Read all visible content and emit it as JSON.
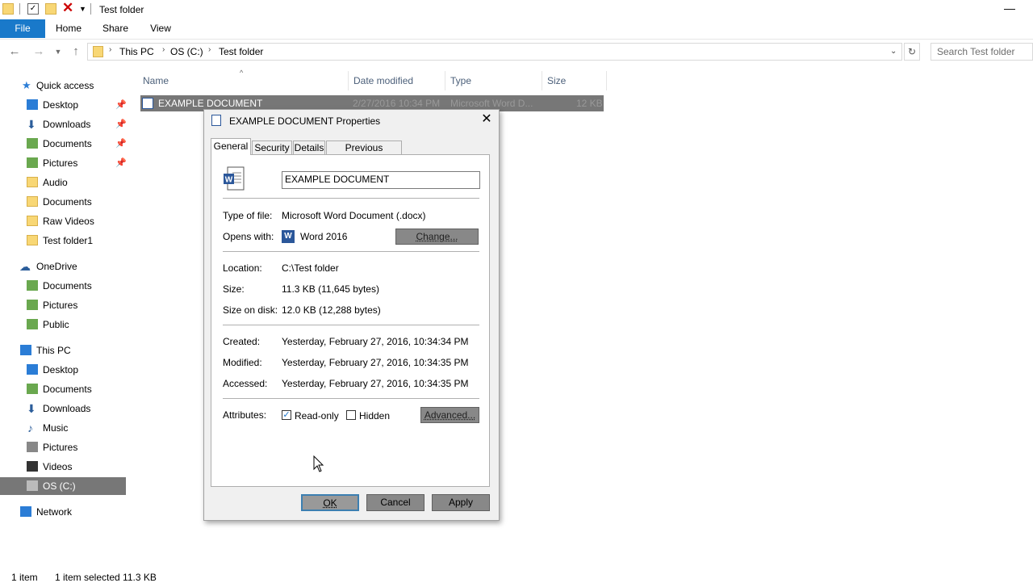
{
  "window": {
    "title": "Test folder"
  },
  "ribbon": {
    "tabs": [
      "File",
      "Home",
      "Share",
      "View"
    ]
  },
  "address": {
    "crumbs": [
      "This PC",
      "OS (C:)",
      "Test folder"
    ],
    "search_placeholder": "Search Test folder"
  },
  "nav": {
    "quick_access": "Quick access",
    "qa_items": [
      "Desktop",
      "Downloads",
      "Documents",
      "Pictures",
      "Audio",
      "Documents",
      "Raw Videos",
      "Test folder1"
    ],
    "onedrive": "OneDrive",
    "onedrive_items": [
      "Documents",
      "Pictures",
      "Public"
    ],
    "this_pc": "This PC",
    "pc_items": [
      "Desktop",
      "Documents",
      "Downloads",
      "Music",
      "Pictures",
      "Videos",
      "OS (C:)"
    ],
    "network": "Network"
  },
  "columns": {
    "name": "Name",
    "date": "Date modified",
    "type": "Type",
    "size": "Size"
  },
  "file": {
    "name": "EXAMPLE DOCUMENT",
    "date": "2/27/2016 10:34 PM",
    "type": "Microsoft Word D...",
    "size": "12 KB"
  },
  "status": {
    "count": "1 item",
    "selected": "1 item selected  11.3 KB"
  },
  "dialog": {
    "title": "EXAMPLE DOCUMENT Properties",
    "tabs": [
      "General",
      "Security",
      "Details",
      "Previous Versions"
    ],
    "name_value": "EXAMPLE DOCUMENT",
    "type_label": "Type of file:",
    "type_value": "Microsoft Word Document (.docx)",
    "opens_label": "Opens with:",
    "opens_value": "Word 2016",
    "change_btn": "Change...",
    "location_label": "Location:",
    "location_value": "C:\\Test folder",
    "size_label": "Size:",
    "size_value": "11.3 KB (11,645 bytes)",
    "sizedisk_label": "Size on disk:",
    "sizedisk_value": "12.0 KB (12,288 bytes)",
    "created_label": "Created:",
    "created_value": "Yesterday, February 27, 2016, 10:34:34 PM",
    "modified_label": "Modified:",
    "modified_value": "Yesterday, February 27, 2016, 10:34:35 PM",
    "accessed_label": "Accessed:",
    "accessed_value": "Yesterday, February 27, 2016, 10:34:35 PM",
    "attributes_label": "Attributes:",
    "readonly_label": "Read-only",
    "readonly_checked": true,
    "hidden_label": "Hidden",
    "hidden_checked": false,
    "advanced_btn": "Advanced...",
    "ok_btn": "OK",
    "cancel_btn": "Cancel",
    "apply_btn": "Apply"
  }
}
